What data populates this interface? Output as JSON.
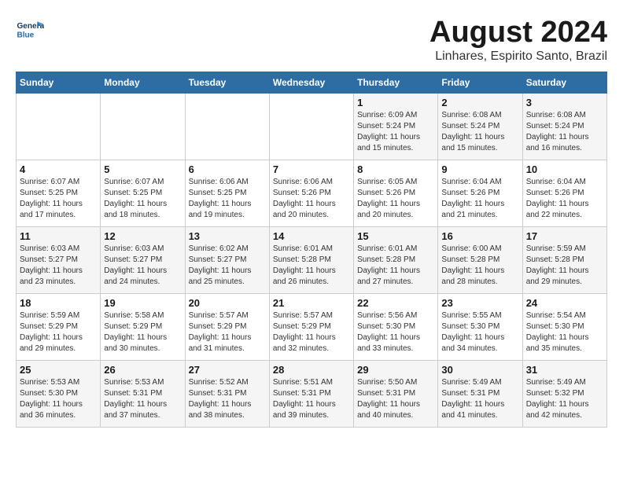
{
  "header": {
    "logo_general": "General",
    "logo_blue": "Blue",
    "month_title": "August 2024",
    "subtitle": "Linhares, Espirito Santo, Brazil"
  },
  "weekdays": [
    "Sunday",
    "Monday",
    "Tuesday",
    "Wednesday",
    "Thursday",
    "Friday",
    "Saturday"
  ],
  "weeks": [
    [
      {
        "day": "",
        "info": ""
      },
      {
        "day": "",
        "info": ""
      },
      {
        "day": "",
        "info": ""
      },
      {
        "day": "",
        "info": ""
      },
      {
        "day": "1",
        "info": "Sunrise: 6:09 AM\nSunset: 5:24 PM\nDaylight: 11 hours\nand 15 minutes."
      },
      {
        "day": "2",
        "info": "Sunrise: 6:08 AM\nSunset: 5:24 PM\nDaylight: 11 hours\nand 15 minutes."
      },
      {
        "day": "3",
        "info": "Sunrise: 6:08 AM\nSunset: 5:24 PM\nDaylight: 11 hours\nand 16 minutes."
      }
    ],
    [
      {
        "day": "4",
        "info": "Sunrise: 6:07 AM\nSunset: 5:25 PM\nDaylight: 11 hours\nand 17 minutes."
      },
      {
        "day": "5",
        "info": "Sunrise: 6:07 AM\nSunset: 5:25 PM\nDaylight: 11 hours\nand 18 minutes."
      },
      {
        "day": "6",
        "info": "Sunrise: 6:06 AM\nSunset: 5:25 PM\nDaylight: 11 hours\nand 19 minutes."
      },
      {
        "day": "7",
        "info": "Sunrise: 6:06 AM\nSunset: 5:26 PM\nDaylight: 11 hours\nand 20 minutes."
      },
      {
        "day": "8",
        "info": "Sunrise: 6:05 AM\nSunset: 5:26 PM\nDaylight: 11 hours\nand 20 minutes."
      },
      {
        "day": "9",
        "info": "Sunrise: 6:04 AM\nSunset: 5:26 PM\nDaylight: 11 hours\nand 21 minutes."
      },
      {
        "day": "10",
        "info": "Sunrise: 6:04 AM\nSunset: 5:26 PM\nDaylight: 11 hours\nand 22 minutes."
      }
    ],
    [
      {
        "day": "11",
        "info": "Sunrise: 6:03 AM\nSunset: 5:27 PM\nDaylight: 11 hours\nand 23 minutes."
      },
      {
        "day": "12",
        "info": "Sunrise: 6:03 AM\nSunset: 5:27 PM\nDaylight: 11 hours\nand 24 minutes."
      },
      {
        "day": "13",
        "info": "Sunrise: 6:02 AM\nSunset: 5:27 PM\nDaylight: 11 hours\nand 25 minutes."
      },
      {
        "day": "14",
        "info": "Sunrise: 6:01 AM\nSunset: 5:28 PM\nDaylight: 11 hours\nand 26 minutes."
      },
      {
        "day": "15",
        "info": "Sunrise: 6:01 AM\nSunset: 5:28 PM\nDaylight: 11 hours\nand 27 minutes."
      },
      {
        "day": "16",
        "info": "Sunrise: 6:00 AM\nSunset: 5:28 PM\nDaylight: 11 hours\nand 28 minutes."
      },
      {
        "day": "17",
        "info": "Sunrise: 5:59 AM\nSunset: 5:28 PM\nDaylight: 11 hours\nand 29 minutes."
      }
    ],
    [
      {
        "day": "18",
        "info": "Sunrise: 5:59 AM\nSunset: 5:29 PM\nDaylight: 11 hours\nand 29 minutes."
      },
      {
        "day": "19",
        "info": "Sunrise: 5:58 AM\nSunset: 5:29 PM\nDaylight: 11 hours\nand 30 minutes."
      },
      {
        "day": "20",
        "info": "Sunrise: 5:57 AM\nSunset: 5:29 PM\nDaylight: 11 hours\nand 31 minutes."
      },
      {
        "day": "21",
        "info": "Sunrise: 5:57 AM\nSunset: 5:29 PM\nDaylight: 11 hours\nand 32 minutes."
      },
      {
        "day": "22",
        "info": "Sunrise: 5:56 AM\nSunset: 5:30 PM\nDaylight: 11 hours\nand 33 minutes."
      },
      {
        "day": "23",
        "info": "Sunrise: 5:55 AM\nSunset: 5:30 PM\nDaylight: 11 hours\nand 34 minutes."
      },
      {
        "day": "24",
        "info": "Sunrise: 5:54 AM\nSunset: 5:30 PM\nDaylight: 11 hours\nand 35 minutes."
      }
    ],
    [
      {
        "day": "25",
        "info": "Sunrise: 5:53 AM\nSunset: 5:30 PM\nDaylight: 11 hours\nand 36 minutes."
      },
      {
        "day": "26",
        "info": "Sunrise: 5:53 AM\nSunset: 5:31 PM\nDaylight: 11 hours\nand 37 minutes."
      },
      {
        "day": "27",
        "info": "Sunrise: 5:52 AM\nSunset: 5:31 PM\nDaylight: 11 hours\nand 38 minutes."
      },
      {
        "day": "28",
        "info": "Sunrise: 5:51 AM\nSunset: 5:31 PM\nDaylight: 11 hours\nand 39 minutes."
      },
      {
        "day": "29",
        "info": "Sunrise: 5:50 AM\nSunset: 5:31 PM\nDaylight: 11 hours\nand 40 minutes."
      },
      {
        "day": "30",
        "info": "Sunrise: 5:49 AM\nSunset: 5:31 PM\nDaylight: 11 hours\nand 41 minutes."
      },
      {
        "day": "31",
        "info": "Sunrise: 5:49 AM\nSunset: 5:32 PM\nDaylight: 11 hours\nand 42 minutes."
      }
    ]
  ]
}
